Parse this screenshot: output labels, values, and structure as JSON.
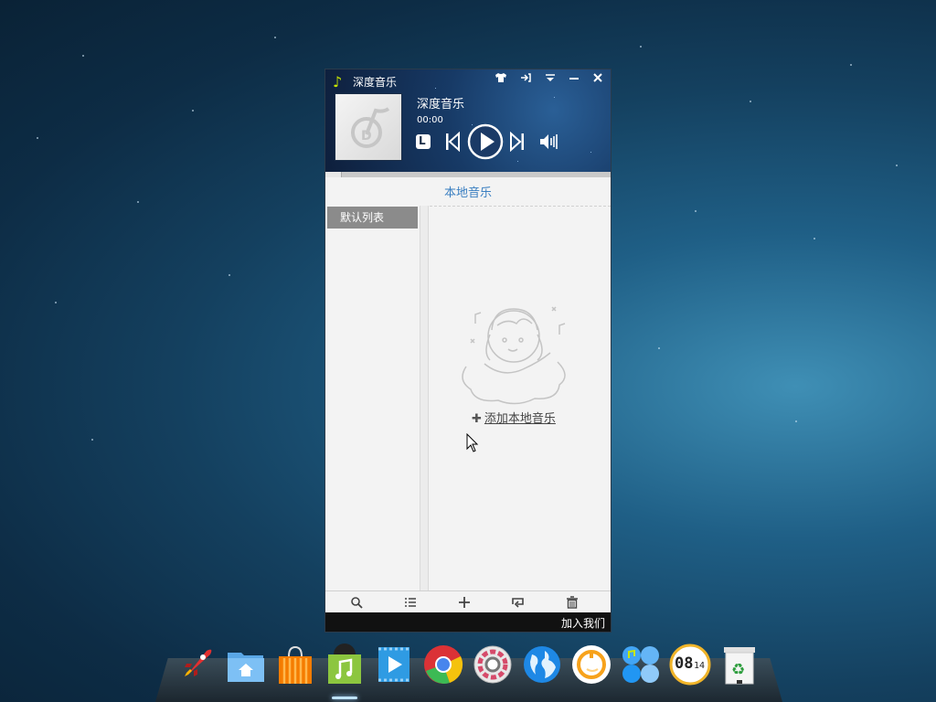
{
  "window": {
    "app_title": "深度音乐",
    "titlebar_buttons": [
      "skin-icon",
      "mini-mode-icon",
      "menu-icon",
      "minimize-icon",
      "close-icon"
    ]
  },
  "player": {
    "song_title": "深度音乐",
    "time": "00:00",
    "mode_label": "L"
  },
  "library": {
    "section_title": "本地音乐",
    "playlists": [
      {
        "label": "默认列表",
        "selected": true
      }
    ],
    "add_music_label": "添加本地音乐"
  },
  "bottom_toolbar": [
    "search-icon",
    "list-icon",
    "add-icon",
    "loop-icon",
    "delete-icon"
  ],
  "status": {
    "join_us": "加入我们"
  },
  "dock": {
    "items": [
      "launcher",
      "file-manager",
      "software-center",
      "deepin-music",
      "movie-player",
      "chrome",
      "system-settings",
      "browser",
      "deepin-power",
      "deepin-apps",
      "clock",
      "trash"
    ],
    "clock_text": "08",
    "clock_min": "14"
  },
  "colors": {
    "accent_blue": "#3a7fc1",
    "selected_item": "#8b8b8b",
    "status_bar": "#111111"
  }
}
